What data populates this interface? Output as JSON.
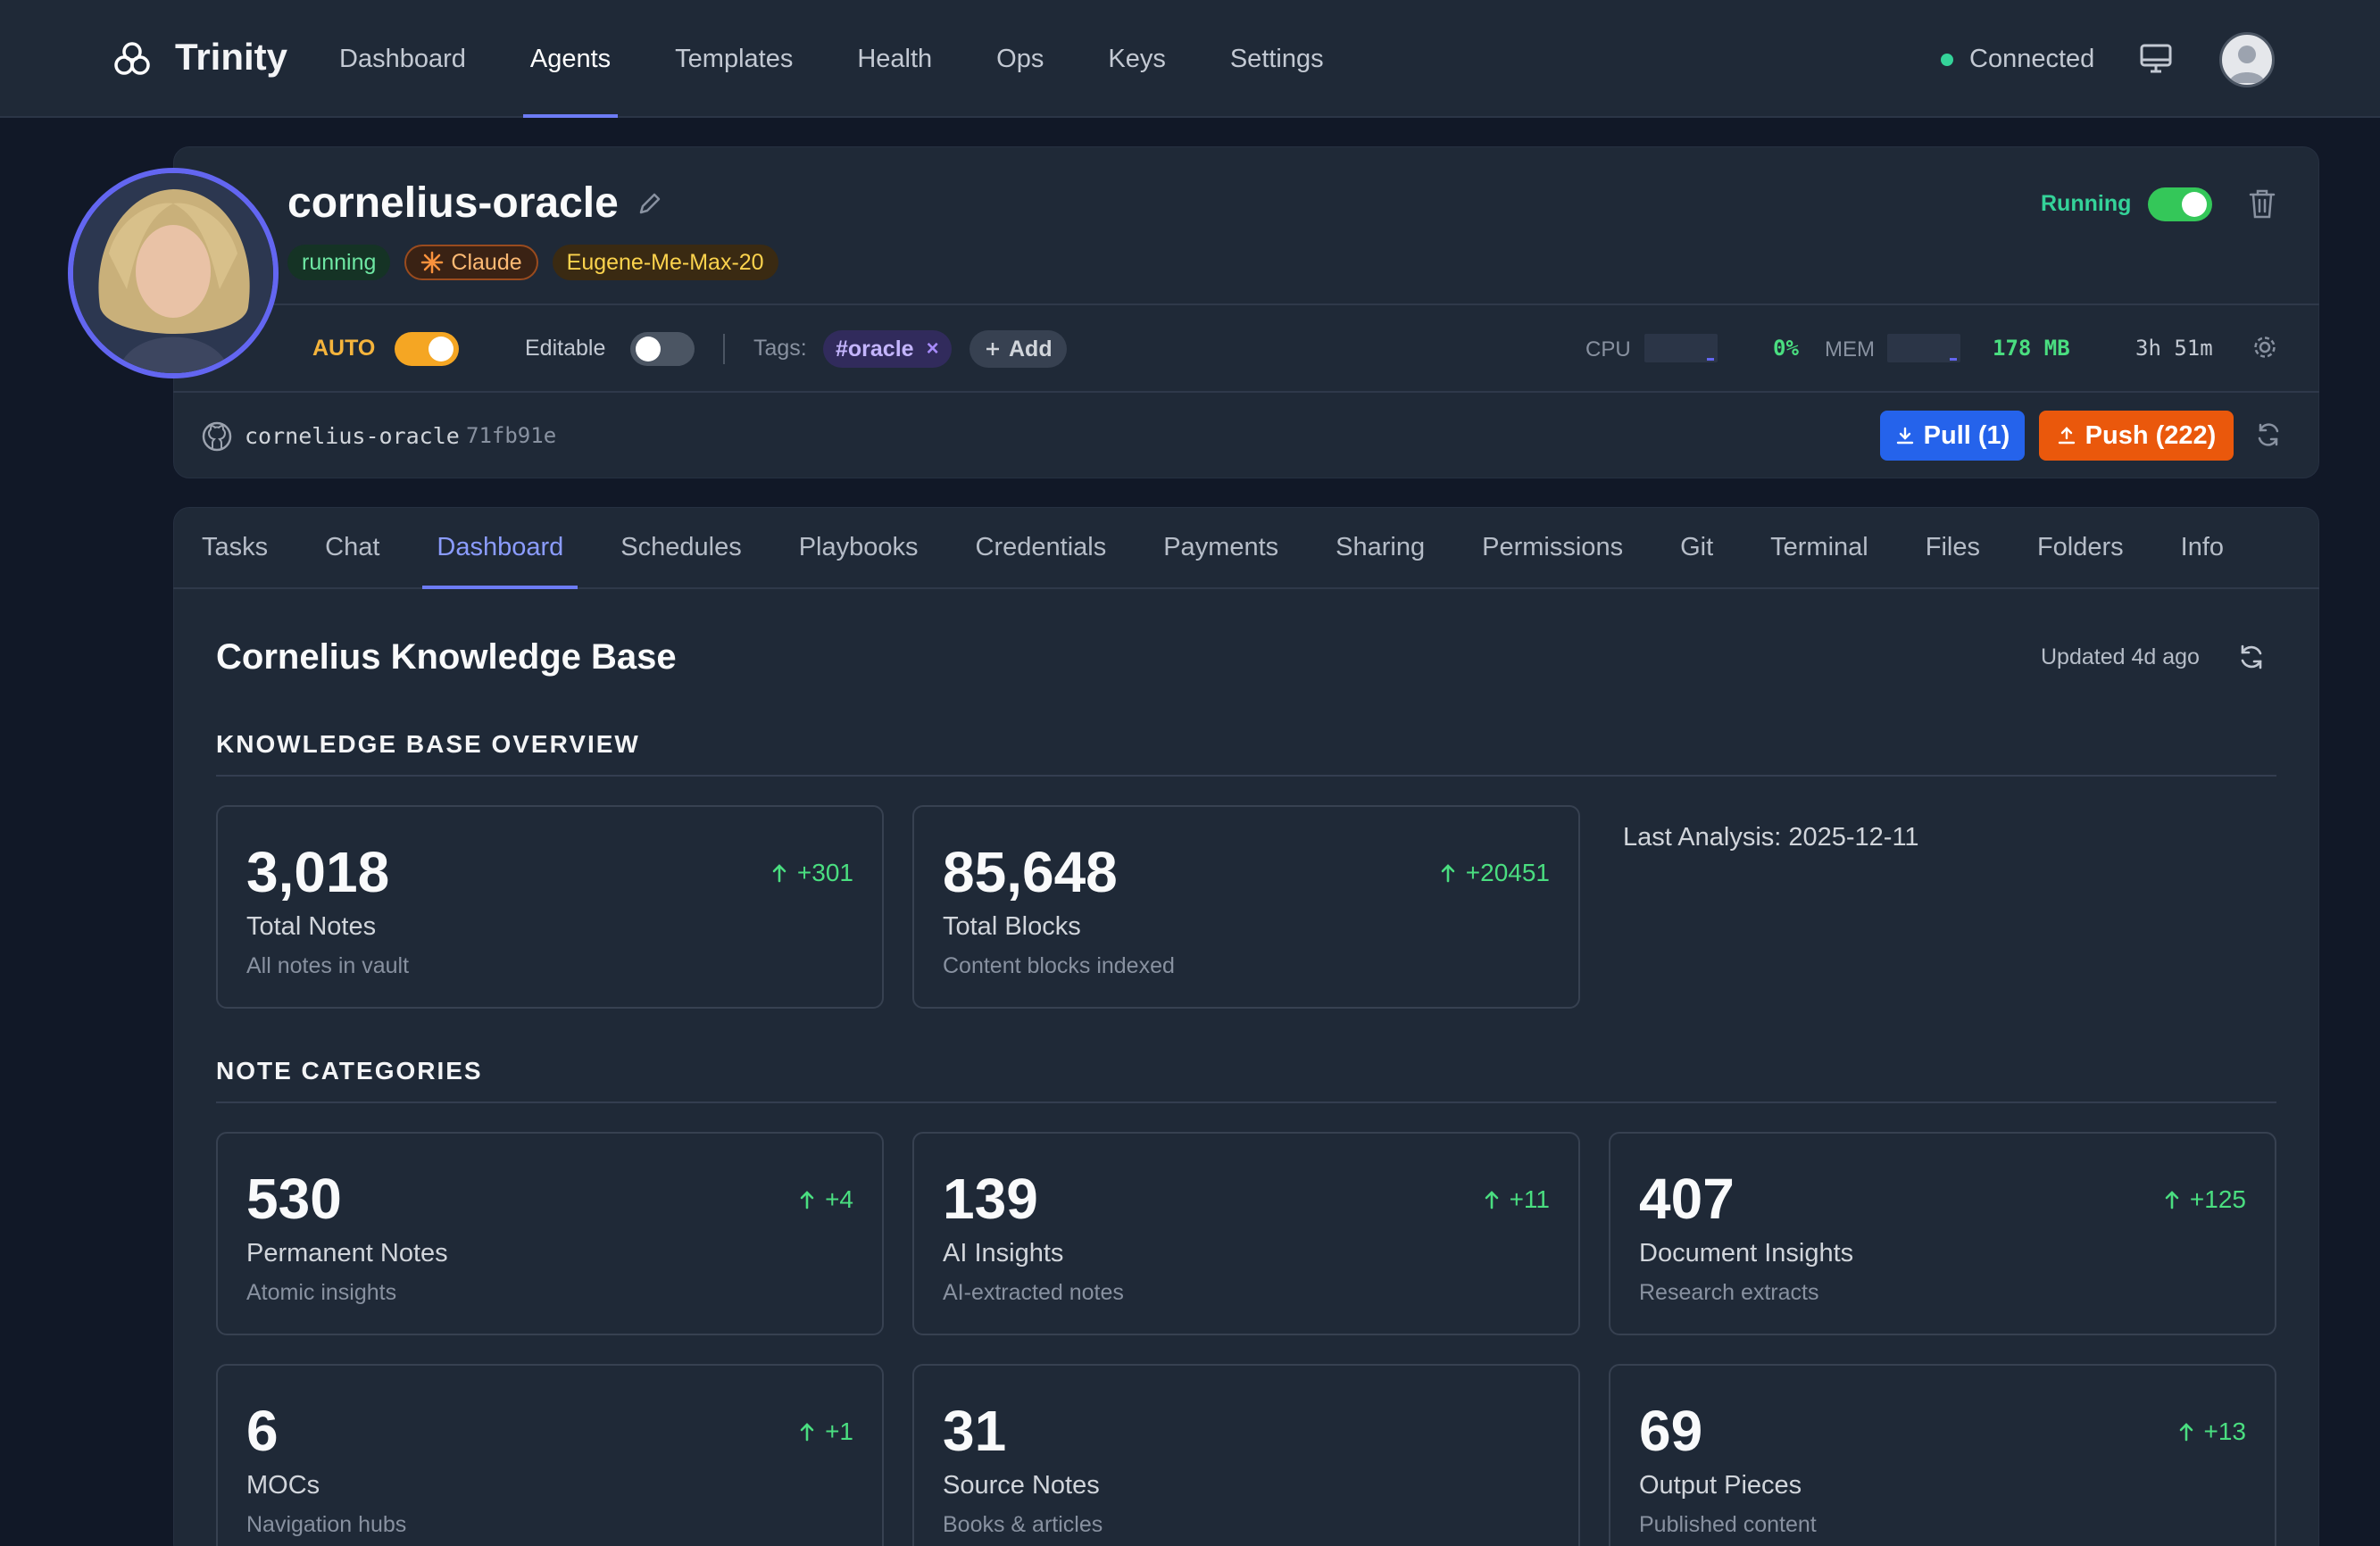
{
  "nav": {
    "brand": "Trinity",
    "links": [
      "Dashboard",
      "Agents",
      "Templates",
      "Health",
      "Ops",
      "Keys",
      "Settings"
    ],
    "active": "Agents",
    "status": "Connected"
  },
  "agent": {
    "name": "cornelius-oracle",
    "badges": {
      "status": "running",
      "model": "Claude",
      "plan": "Eugene-Me-Max-20"
    },
    "run_state": "Running",
    "auto_label": "AUTO",
    "editable_label": "Editable",
    "tags_label": "Tags:",
    "tag": "#oracle",
    "tag_remove": "×",
    "add_tag": "Add",
    "cpu_label": "CPU",
    "cpu_value": "0%",
    "mem_label": "MEM",
    "mem_value": "178 MB",
    "uptime": "3h 51m",
    "repo": "cornelius-oracle",
    "commit": "71fb91e",
    "pull_label": "Pull (1)",
    "push_label": "Push (222)"
  },
  "tabs": [
    "Tasks",
    "Chat",
    "Dashboard",
    "Schedules",
    "Playbooks",
    "Credentials",
    "Payments",
    "Sharing",
    "Permissions",
    "Git",
    "Terminal",
    "Files",
    "Folders",
    "Info"
  ],
  "active_tab": "Dashboard",
  "dashboard": {
    "title": "Cornelius Knowledge Base",
    "updated": "Updated 4d ago",
    "overview_heading": "KNOWLEDGE BASE OVERVIEW",
    "last_analysis": "Last Analysis: 2025-12-11",
    "overview": [
      {
        "value": "3,018",
        "delta": "+301",
        "label": "Total Notes",
        "sub": "All notes in vault"
      },
      {
        "value": "85,648",
        "delta": "+20451",
        "label": "Total Blocks",
        "sub": "Content blocks indexed"
      }
    ],
    "categories_heading": "NOTE CATEGORIES",
    "categories": [
      {
        "value": "530",
        "delta": "+4",
        "label": "Permanent Notes",
        "sub": "Atomic insights"
      },
      {
        "value": "139",
        "delta": "+11",
        "label": "AI Insights",
        "sub": "AI-extracted notes"
      },
      {
        "value": "407",
        "delta": "+125",
        "label": "Document Insights",
        "sub": "Research extracts"
      },
      {
        "value": "6",
        "delta": "+1",
        "label": "MOCs",
        "sub": "Navigation hubs"
      },
      {
        "value": "31",
        "delta": "",
        "label": "Source Notes",
        "sub": "Books & articles"
      },
      {
        "value": "69",
        "delta": "+13",
        "label": "Output Pieces",
        "sub": "Published content"
      }
    ]
  },
  "colors": {
    "accent": "#6d7cf5",
    "success": "#34d399",
    "pull": "#2563eb",
    "push": "#ea580c",
    "auto": "#f5a623"
  }
}
